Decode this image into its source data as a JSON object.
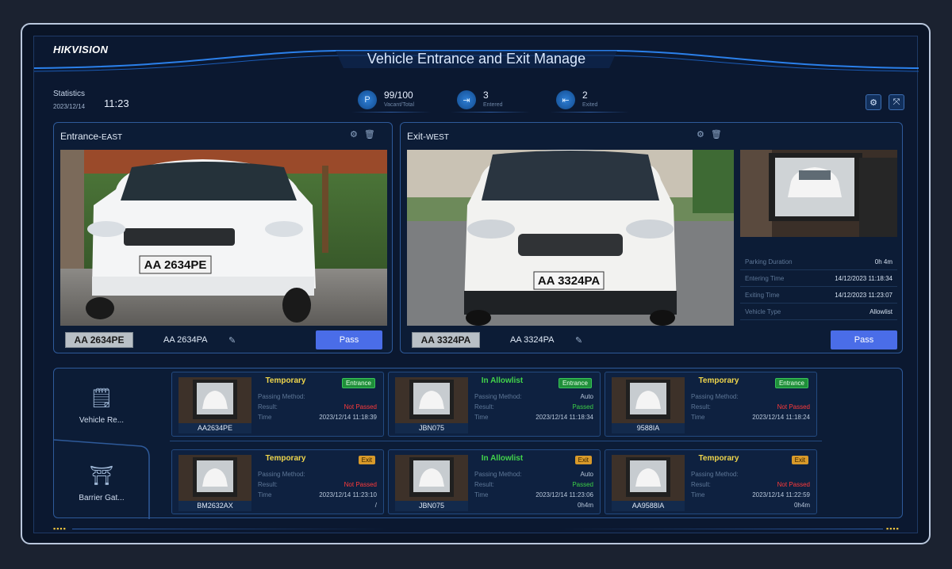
{
  "brand": "HIKVISION",
  "title": "Vehicle Entrance and Exit Manage",
  "statistics": {
    "label": "Statistics",
    "date": "2023/12/14",
    "time": "11:23"
  },
  "stats": [
    {
      "icon": "parking-icon",
      "value": "99/100",
      "sub": "Vacant/Total"
    },
    {
      "icon": "car-entered-icon",
      "value": "3",
      "sub": "Entered"
    },
    {
      "icon": "car-exited-icon",
      "value": "2",
      "sub": "Exited"
    }
  ],
  "entrance": {
    "title": "Entrance-",
    "title_suffix": "EAST",
    "plate_image": "AA 2634PE",
    "plate_number": "AA 2634PE",
    "plate_text": "AA 2634PA",
    "pass_label": "Pass"
  },
  "exit": {
    "title": "Exit-",
    "title_suffix": "WEST",
    "plate_image": "AA 3324PA",
    "plate_number": "AA 3324PA",
    "plate_text": "AA 3324PA",
    "pass_label": "Pass",
    "info": [
      {
        "label": "Parking Duration",
        "value": "0h 4m"
      },
      {
        "label": "Entering Time",
        "value": "14/12/2023 11:18:34"
      },
      {
        "label": "Exiting Time",
        "value": "14/12/2023 11:23:07"
      },
      {
        "label": "Vehicle Type",
        "value": "Allowlist"
      }
    ]
  },
  "tabs": [
    {
      "label": "Vehicle Re..."
    },
    {
      "label": "Barrier Gat..."
    }
  ],
  "record_labels": {
    "method": "Passing Method:",
    "result": "Result:",
    "time": "Time"
  },
  "records": [
    {
      "plate": "AA2634PE",
      "kind": "Temporary",
      "dir": "Entrance",
      "method": "",
      "result": "Not Passed",
      "time": "2023/12/14 11:18:39",
      "extra": ""
    },
    {
      "plate": "JBN075",
      "kind": "In Allowlist",
      "dir": "Entrance",
      "method": "Auto",
      "result": "Passed",
      "time": "2023/12/14 11:18:34",
      "extra": ""
    },
    {
      "plate": "9588IA",
      "kind": "Temporary",
      "dir": "Entrance",
      "method": "",
      "result": "Not Passed",
      "time": "2023/12/14 11:18:24",
      "extra": ""
    },
    {
      "plate": "BM2632AX",
      "kind": "Temporary",
      "dir": "Exit",
      "method": "",
      "result": "Not Passed",
      "time": "2023/12/14 11:23:10",
      "extra": "/"
    },
    {
      "plate": "JBN075",
      "kind": "In Allowlist",
      "dir": "Exit",
      "method": "Auto",
      "result": "Passed",
      "time": "2023/12/14 11:23:06",
      "extra": "0h4m"
    },
    {
      "plate": "AA9588IA",
      "kind": "Temporary",
      "dir": "Exit",
      "method": "",
      "result": "Not Passed",
      "time": "2023/12/14 11:22:59",
      "extra": "0h4m"
    }
  ]
}
